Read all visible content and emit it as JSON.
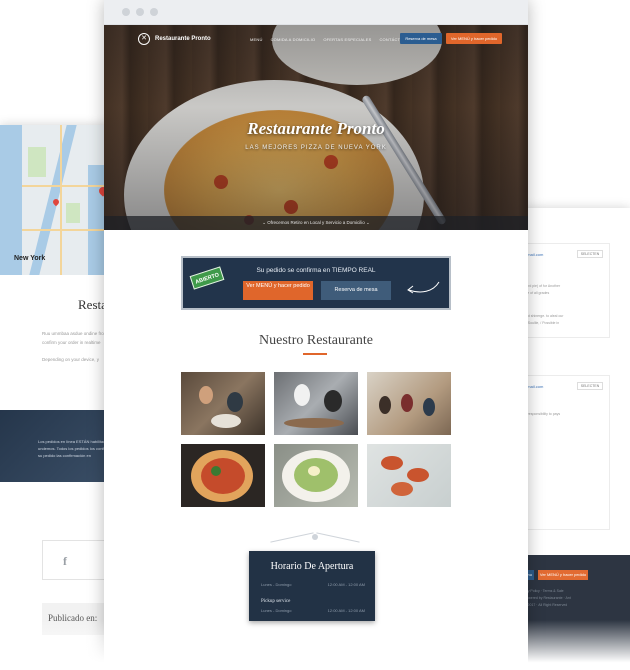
{
  "left_page": {
    "map_city": "New York",
    "title": "Restau",
    "lines": [
      "Ruu ummbaa asdue ondine from",
      "confirm your order in realtime",
      "Depending on your device, y"
    ],
    "banner_lines": [
      "Los pedidos en línea ESTÁN habilitado",
      "undemos. Todos los pedidos los confirm",
      "su pedido las confirmación en"
    ],
    "social_icon": "f",
    "posted_label": "Publicado en:"
  },
  "right_page": {
    "cards": [
      {
        "link": "@gmail.com",
        "button": "SELECTEN",
        "lines": [
          "er (3rd pie) of for Another",
          "circle of all grades",
          "",
          "about shinerge. to aleal our",
          "and Soulile, / Possible in"
        ]
      },
      {
        "link": "@gmail.com",
        "button": "SELECTEN",
        "lines": [
          "you responsibility to pays"
        ]
      }
    ],
    "footer_btn_blue": "enu",
    "footer_btn_orange": "Ver MENÚ y hacer pedido",
    "footer_lines": [
      "ncy Policy  ·  Terms & Sale",
      "Powered by Restaurante · Ant",
      "© 2017 · All Right Reserved"
    ]
  },
  "nav": {
    "logo_icon": "fork-knife-icon",
    "brand": "Restaurante Pronto",
    "links": [
      "MENÚ",
      "COMIDA A DOMICILIO",
      "OFERTAS ESPECIALES",
      "CONTÁCTENOS"
    ],
    "btn_reserve": "Reserva de mesa",
    "btn_menu": "Ver MENÚ y hacer pedido"
  },
  "hero": {
    "title": "Restaurante Pronto",
    "subtitle": "LAS MEJORES PIZZA DE NUEVA YORK",
    "strip": "Ofrecemos Retiro en Local y Servicio a Domicilio"
  },
  "realtime": {
    "badge": "ABIERTO",
    "headline": "Su pedido se confirma en TIEMPO REAL",
    "btn_order": "Ver MENÚ y hacer pedido",
    "btn_reserve": "Reserva de mesa"
  },
  "restaurant": {
    "title": "Nuestro Restaurante",
    "photos": [
      "diners-photo",
      "kitchen-photo",
      "dining-room-photo",
      "pizza-photo",
      "pasta-photo",
      "bruschetta-photo"
    ]
  },
  "hours": {
    "title": "Horario De Apertura",
    "rows": [
      {
        "day": "Lunes - Domingo",
        "time": "12:00 AM - 12:00 AM"
      },
      {
        "day": "Lunes - Domingo",
        "time": "12:00 AM - 12:00 AM"
      }
    ],
    "service": "Pickup service",
    "colors": {
      "navy": "#223245",
      "orange": "#e0662b",
      "blue": "#2b5d91"
    }
  }
}
